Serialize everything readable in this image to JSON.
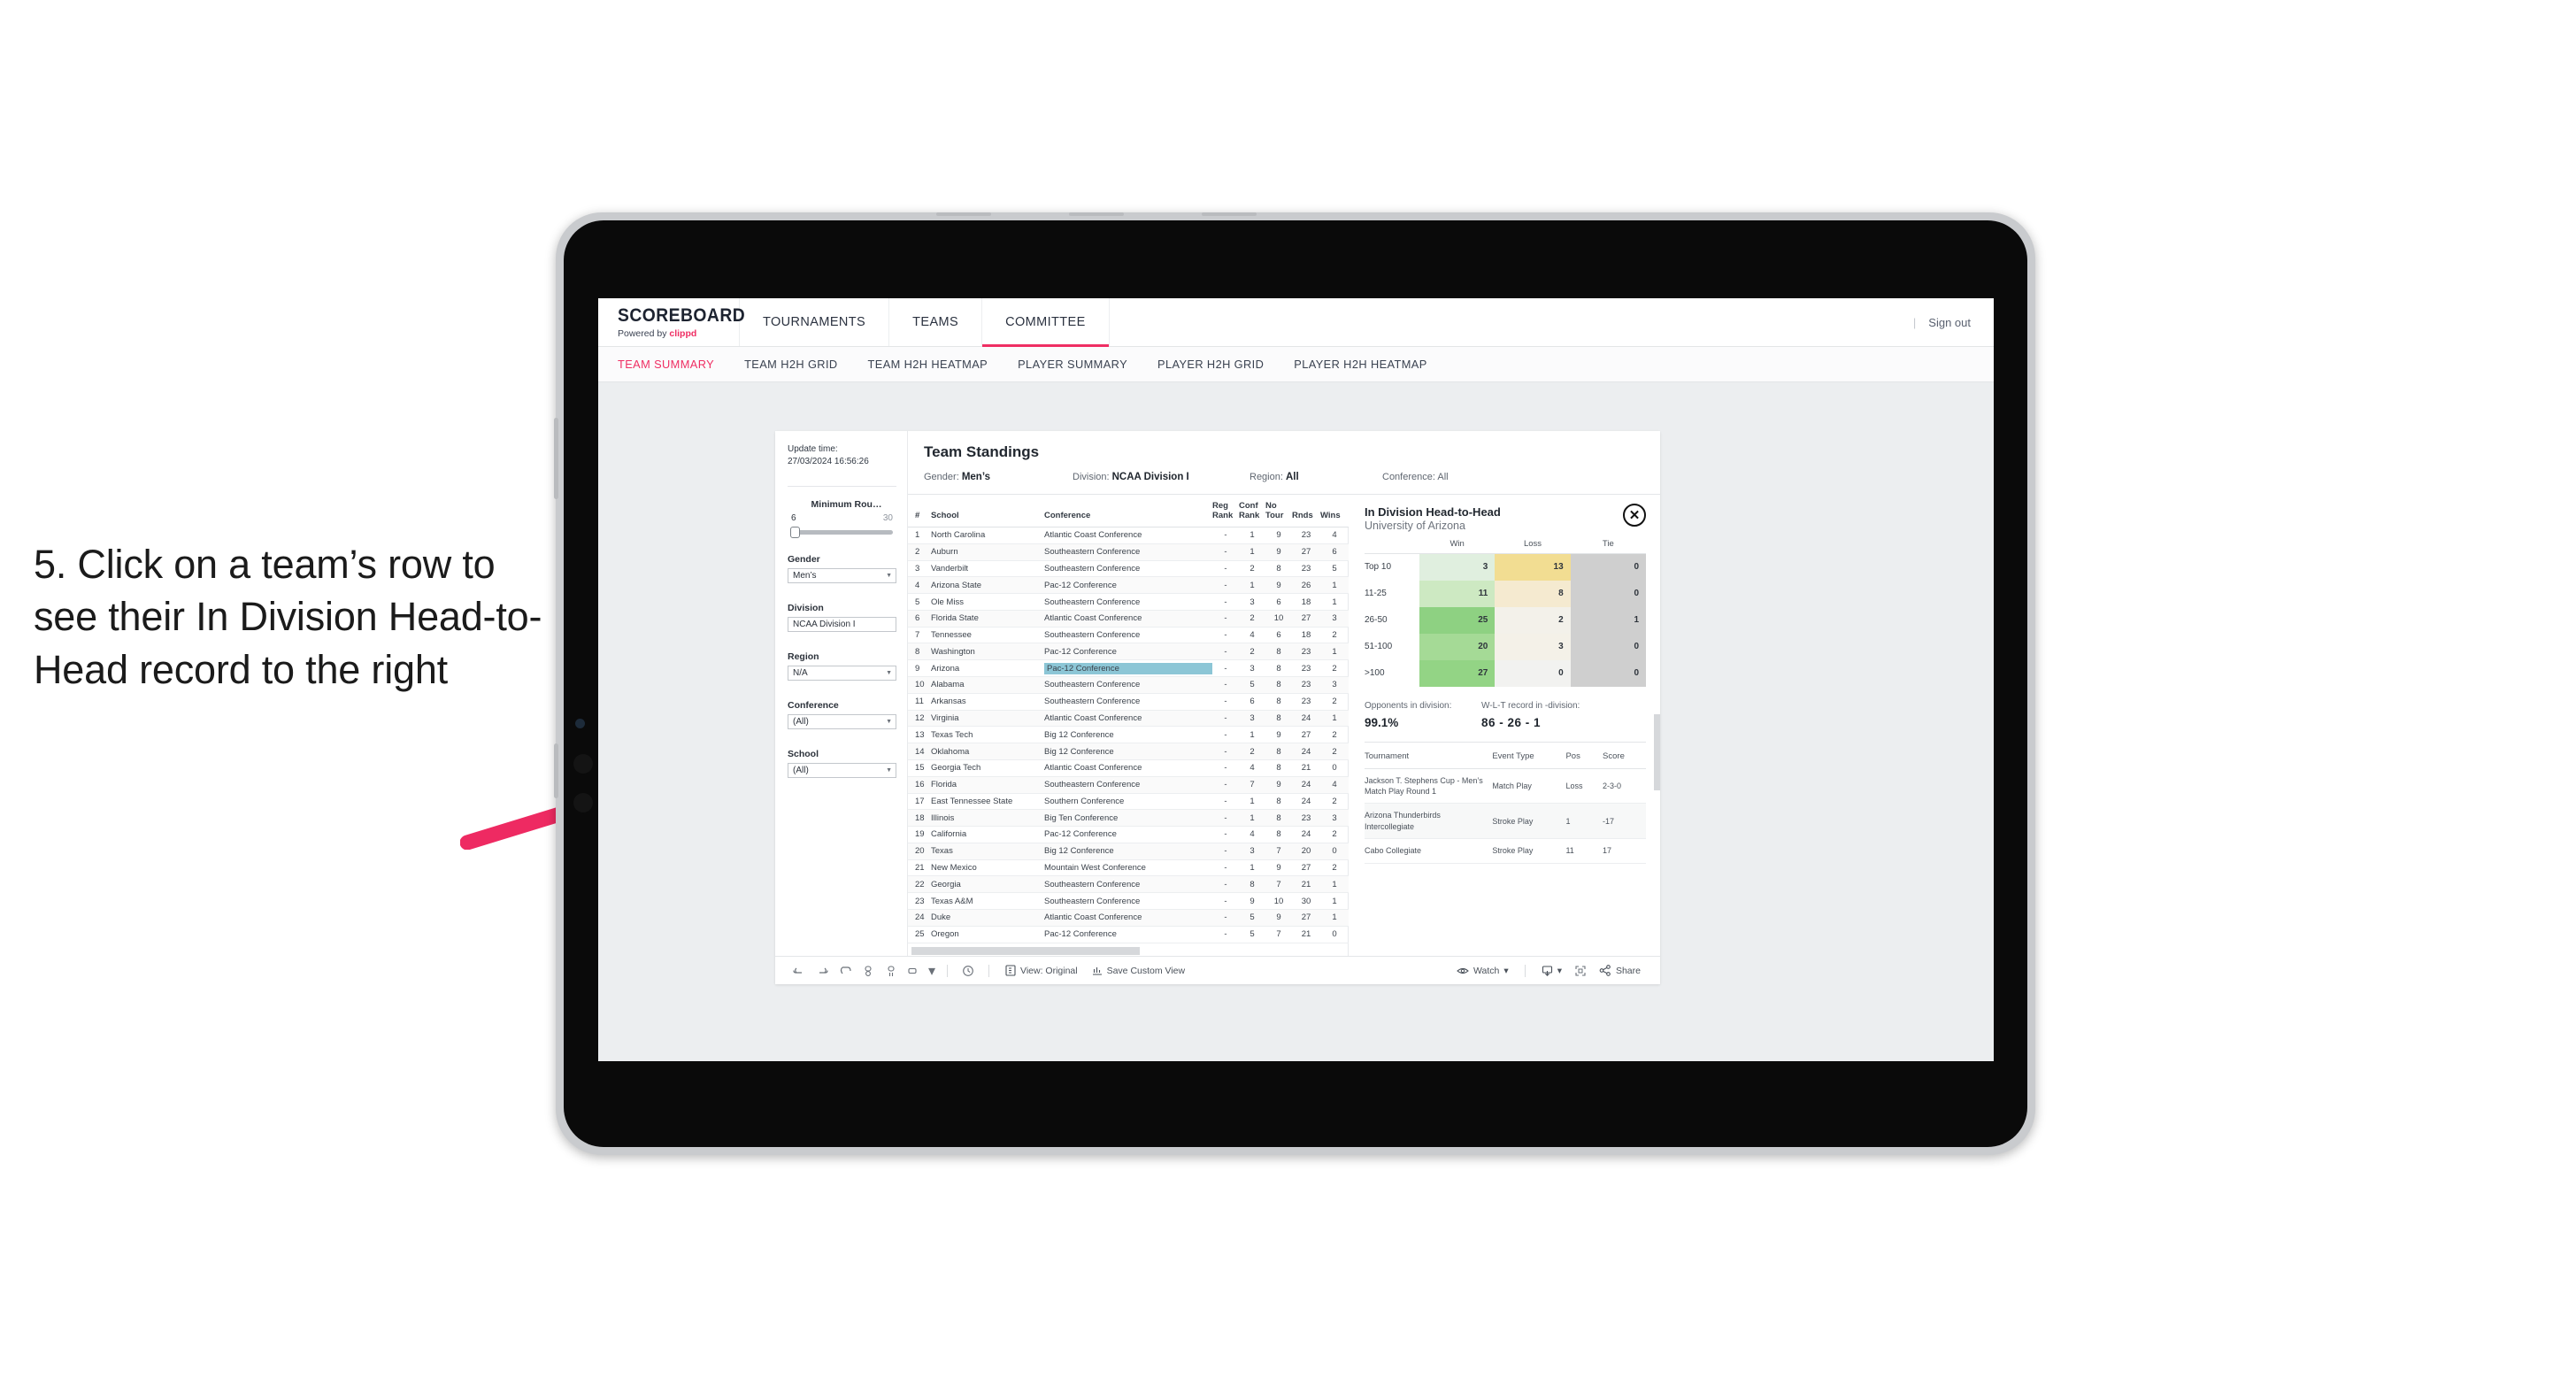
{
  "annotation": {
    "text": "5. Click on a team’s row to see their In Division Head-to-Head record to the right",
    "arrow_color": "#ee2a62"
  },
  "app": {
    "brand": {
      "title": "SCOREBOARD",
      "powered_prefix": "Powered by ",
      "powered_name": "clippd"
    },
    "topnav": {
      "items": [
        {
          "label": "TOURNAMENTS",
          "active": false
        },
        {
          "label": "TEAMS",
          "active": false
        },
        {
          "label": "COMMITTEE",
          "active": true
        }
      ],
      "divider": "|",
      "sign_out": "Sign out"
    },
    "subnav": {
      "tabs": [
        {
          "label": "TEAM SUMMARY",
          "active": true
        },
        {
          "label": "TEAM H2H GRID",
          "active": false
        },
        {
          "label": "TEAM H2H HEATMAP",
          "active": false
        },
        {
          "label": "PLAYER SUMMARY",
          "active": false
        },
        {
          "label": "PLAYER H2H GRID",
          "active": false
        },
        {
          "label": "PLAYER H2H HEATMAP",
          "active": false
        }
      ]
    }
  },
  "rail": {
    "update_label": "Update time:",
    "update_value": "27/03/2024 16:56:26",
    "slider": {
      "title": "Minimum Rou…",
      "min": "6",
      "max": "30"
    },
    "filters": [
      {
        "label": "Gender",
        "value": "Men’s",
        "caret": true
      },
      {
        "label": "Division",
        "value": "NCAA Division I",
        "caret": false
      },
      {
        "label": "Region",
        "value": "N/A",
        "caret": true
      },
      {
        "label": "Conference",
        "value": "(All)",
        "caret": true
      },
      {
        "label": "School",
        "value": "(All)",
        "caret": true
      }
    ]
  },
  "standings": {
    "title": "Team Standings",
    "meta": [
      {
        "label": "Gender: ",
        "value": "Men’s"
      },
      {
        "label": "Division: ",
        "value": "NCAA Division I"
      },
      {
        "label": "Region: ",
        "value": "All"
      },
      {
        "label": "Conference: ",
        "value": "All"
      }
    ],
    "columns": [
      "#",
      "School",
      "Conference",
      "Reg Rank",
      "Conf Rank",
      "No Tour",
      "Rnds",
      "Wins"
    ],
    "rows": [
      {
        "rank": "1",
        "school": "North Carolina",
        "conference": "Atlantic Coast Conference",
        "reg": "-",
        "conf": "1",
        "notour": "9",
        "rnds": "23",
        "wins": "4",
        "selected": false
      },
      {
        "rank": "2",
        "school": "Auburn",
        "conference": "Southeastern Conference",
        "reg": "-",
        "conf": "1",
        "notour": "9",
        "rnds": "27",
        "wins": "6",
        "selected": false
      },
      {
        "rank": "3",
        "school": "Vanderbilt",
        "conference": "Southeastern Conference",
        "reg": "-",
        "conf": "2",
        "notour": "8",
        "rnds": "23",
        "wins": "5",
        "selected": false
      },
      {
        "rank": "4",
        "school": "Arizona State",
        "conference": "Pac-12 Conference",
        "reg": "-",
        "conf": "1",
        "notour": "9",
        "rnds": "26",
        "wins": "1",
        "selected": false
      },
      {
        "rank": "5",
        "school": "Ole Miss",
        "conference": "Southeastern Conference",
        "reg": "-",
        "conf": "3",
        "notour": "6",
        "rnds": "18",
        "wins": "1",
        "selected": false
      },
      {
        "rank": "6",
        "school": "Florida State",
        "conference": "Atlantic Coast Conference",
        "reg": "-",
        "conf": "2",
        "notour": "10",
        "rnds": "27",
        "wins": "3",
        "selected": false
      },
      {
        "rank": "7",
        "school": "Tennessee",
        "conference": "Southeastern Conference",
        "reg": "-",
        "conf": "4",
        "notour": "6",
        "rnds": "18",
        "wins": "2",
        "selected": false
      },
      {
        "rank": "8",
        "school": "Washington",
        "conference": "Pac-12 Conference",
        "reg": "-",
        "conf": "2",
        "notour": "8",
        "rnds": "23",
        "wins": "1",
        "selected": false
      },
      {
        "rank": "9",
        "school": "Arizona",
        "conference": "Pac-12 Conference",
        "reg": "-",
        "conf": "3",
        "notour": "8",
        "rnds": "23",
        "wins": "2",
        "selected": true
      },
      {
        "rank": "10",
        "school": "Alabama",
        "conference": "Southeastern Conference",
        "reg": "-",
        "conf": "5",
        "notour": "8",
        "rnds": "23",
        "wins": "3",
        "selected": false
      },
      {
        "rank": "11",
        "school": "Arkansas",
        "conference": "Southeastern Conference",
        "reg": "-",
        "conf": "6",
        "notour": "8",
        "rnds": "23",
        "wins": "2",
        "selected": false
      },
      {
        "rank": "12",
        "school": "Virginia",
        "conference": "Atlantic Coast Conference",
        "reg": "-",
        "conf": "3",
        "notour": "8",
        "rnds": "24",
        "wins": "1",
        "selected": false
      },
      {
        "rank": "13",
        "school": "Texas Tech",
        "conference": "Big 12 Conference",
        "reg": "-",
        "conf": "1",
        "notour": "9",
        "rnds": "27",
        "wins": "2",
        "selected": false
      },
      {
        "rank": "14",
        "school": "Oklahoma",
        "conference": "Big 12 Conference",
        "reg": "-",
        "conf": "2",
        "notour": "8",
        "rnds": "24",
        "wins": "2",
        "selected": false
      },
      {
        "rank": "15",
        "school": "Georgia Tech",
        "conference": "Atlantic Coast Conference",
        "reg": "-",
        "conf": "4",
        "notour": "8",
        "rnds": "21",
        "wins": "0",
        "selected": false
      },
      {
        "rank": "16",
        "school": "Florida",
        "conference": "Southeastern Conference",
        "reg": "-",
        "conf": "7",
        "notour": "9",
        "rnds": "24",
        "wins": "4",
        "selected": false
      },
      {
        "rank": "17",
        "school": "East Tennessee State",
        "conference": "Southern Conference",
        "reg": "-",
        "conf": "1",
        "notour": "8",
        "rnds": "24",
        "wins": "2",
        "selected": false
      },
      {
        "rank": "18",
        "school": "Illinois",
        "conference": "Big Ten Conference",
        "reg": "-",
        "conf": "1",
        "notour": "8",
        "rnds": "23",
        "wins": "3",
        "selected": false
      },
      {
        "rank": "19",
        "school": "California",
        "conference": "Pac-12 Conference",
        "reg": "-",
        "conf": "4",
        "notour": "8",
        "rnds": "24",
        "wins": "2",
        "selected": false
      },
      {
        "rank": "20",
        "school": "Texas",
        "conference": "Big 12 Conference",
        "reg": "-",
        "conf": "3",
        "notour": "7",
        "rnds": "20",
        "wins": "0",
        "selected": false
      },
      {
        "rank": "21",
        "school": "New Mexico",
        "conference": "Mountain West Conference",
        "reg": "-",
        "conf": "1",
        "notour": "9",
        "rnds": "27",
        "wins": "2",
        "selected": false
      },
      {
        "rank": "22",
        "school": "Georgia",
        "conference": "Southeastern Conference",
        "reg": "-",
        "conf": "8",
        "notour": "7",
        "rnds": "21",
        "wins": "1",
        "selected": false
      },
      {
        "rank": "23",
        "school": "Texas A&M",
        "conference": "Southeastern Conference",
        "reg": "-",
        "conf": "9",
        "notour": "10",
        "rnds": "30",
        "wins": "1",
        "selected": false
      },
      {
        "rank": "24",
        "school": "Duke",
        "conference": "Atlantic Coast Conference",
        "reg": "-",
        "conf": "5",
        "notour": "9",
        "rnds": "27",
        "wins": "1",
        "selected": false
      },
      {
        "rank": "25",
        "school": "Oregon",
        "conference": "Pac-12 Conference",
        "reg": "-",
        "conf": "5",
        "notour": "7",
        "rnds": "21",
        "wins": "0",
        "selected": false
      }
    ]
  },
  "h2h": {
    "title": "In Division Head-to-Head",
    "subtitle": "University of Arizona",
    "close_icon": "✕",
    "columns": [
      "",
      "Win",
      "Loss",
      "Tie"
    ],
    "rows": [
      {
        "band": "Top 10",
        "win": "3",
        "loss": "13",
        "tie": "0",
        "win_color": "#e0efdf",
        "loss_color": "#f2dd92",
        "tie_color": "#cfcfcf"
      },
      {
        "band": "11-25",
        "win": "11",
        "loss": "8",
        "tie": "0",
        "win_color": "#cde9c2",
        "loss_color": "#f5ead0",
        "tie_color": "#cfcfcf"
      },
      {
        "band": "26-50",
        "win": "25",
        "loss": "2",
        "tie": "1",
        "win_color": "#8ed182",
        "loss_color": "#f3f1ea",
        "tie_color": "#cfcfcf"
      },
      {
        "band": "51-100",
        "win": "20",
        "loss": "3",
        "tie": "0",
        "win_color": "#a5da96",
        "loss_color": "#f4f1e8",
        "tie_color": "#cfcfcf"
      },
      {
        "band": ">100",
        "win": "27",
        "loss": "0",
        "tie": "0",
        "win_color": "#93d485",
        "loss_color": "#f2f2f0",
        "tie_color": "#cfcfcf"
      }
    ],
    "stats": [
      {
        "caption": "Opponents in division:",
        "value": "99.1%"
      },
      {
        "caption": "W-L-T record in -division:",
        "value": "86 - 26 - 1"
      }
    ],
    "tournament_columns": [
      "Tournament",
      "Event Type",
      "Pos",
      "Score"
    ],
    "tournaments": [
      {
        "name": "Jackson T. Stephens Cup - Men’s Match Play Round 1",
        "type": "Match Play",
        "pos": "Loss",
        "score": "2-3-0"
      },
      {
        "name": "Arizona Thunderbirds Intercollegiate",
        "type": "Stroke Play",
        "pos": "1",
        "score": "-17"
      },
      {
        "name": "Cabo Collegiate",
        "type": "Stroke Play",
        "pos": "11",
        "score": "17"
      }
    ]
  },
  "toolbar": {
    "view_label": "View: Original",
    "save_label": "Save Custom View",
    "watch_label": "Watch",
    "share_label": "Share",
    "caret": "▾"
  }
}
